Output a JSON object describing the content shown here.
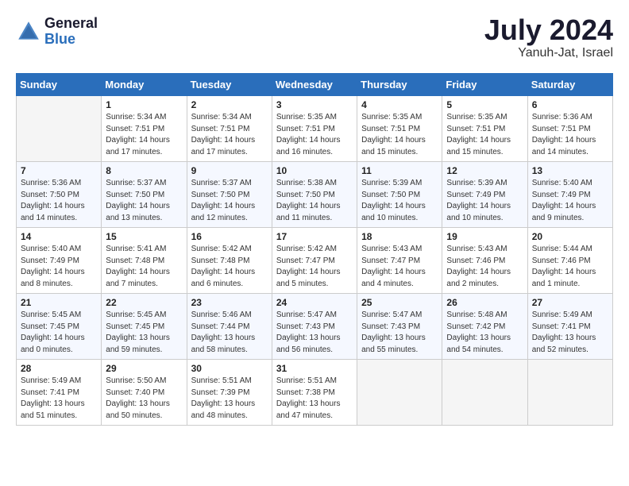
{
  "header": {
    "logo_general": "General",
    "logo_blue": "Blue",
    "month_year": "July 2024",
    "location": "Yanuh-Jat, Israel"
  },
  "days_of_week": [
    "Sunday",
    "Monday",
    "Tuesday",
    "Wednesday",
    "Thursday",
    "Friday",
    "Saturday"
  ],
  "weeks": [
    [
      {
        "day": "",
        "sunrise": "",
        "sunset": "",
        "daylight": ""
      },
      {
        "day": "1",
        "sunrise": "Sunrise: 5:34 AM",
        "sunset": "Sunset: 7:51 PM",
        "daylight": "Daylight: 14 hours and 17 minutes."
      },
      {
        "day": "2",
        "sunrise": "Sunrise: 5:34 AM",
        "sunset": "Sunset: 7:51 PM",
        "daylight": "Daylight: 14 hours and 17 minutes."
      },
      {
        "day": "3",
        "sunrise": "Sunrise: 5:35 AM",
        "sunset": "Sunset: 7:51 PM",
        "daylight": "Daylight: 14 hours and 16 minutes."
      },
      {
        "day": "4",
        "sunrise": "Sunrise: 5:35 AM",
        "sunset": "Sunset: 7:51 PM",
        "daylight": "Daylight: 14 hours and 15 minutes."
      },
      {
        "day": "5",
        "sunrise": "Sunrise: 5:35 AM",
        "sunset": "Sunset: 7:51 PM",
        "daylight": "Daylight: 14 hours and 15 minutes."
      },
      {
        "day": "6",
        "sunrise": "Sunrise: 5:36 AM",
        "sunset": "Sunset: 7:51 PM",
        "daylight": "Daylight: 14 hours and 14 minutes."
      }
    ],
    [
      {
        "day": "7",
        "sunrise": "Sunrise: 5:36 AM",
        "sunset": "Sunset: 7:50 PM",
        "daylight": "Daylight: 14 hours and 14 minutes."
      },
      {
        "day": "8",
        "sunrise": "Sunrise: 5:37 AM",
        "sunset": "Sunset: 7:50 PM",
        "daylight": "Daylight: 14 hours and 13 minutes."
      },
      {
        "day": "9",
        "sunrise": "Sunrise: 5:37 AM",
        "sunset": "Sunset: 7:50 PM",
        "daylight": "Daylight: 14 hours and 12 minutes."
      },
      {
        "day": "10",
        "sunrise": "Sunrise: 5:38 AM",
        "sunset": "Sunset: 7:50 PM",
        "daylight": "Daylight: 14 hours and 11 minutes."
      },
      {
        "day": "11",
        "sunrise": "Sunrise: 5:39 AM",
        "sunset": "Sunset: 7:50 PM",
        "daylight": "Daylight: 14 hours and 10 minutes."
      },
      {
        "day": "12",
        "sunrise": "Sunrise: 5:39 AM",
        "sunset": "Sunset: 7:49 PM",
        "daylight": "Daylight: 14 hours and 10 minutes."
      },
      {
        "day": "13",
        "sunrise": "Sunrise: 5:40 AM",
        "sunset": "Sunset: 7:49 PM",
        "daylight": "Daylight: 14 hours and 9 minutes."
      }
    ],
    [
      {
        "day": "14",
        "sunrise": "Sunrise: 5:40 AM",
        "sunset": "Sunset: 7:49 PM",
        "daylight": "Daylight: 14 hours and 8 minutes."
      },
      {
        "day": "15",
        "sunrise": "Sunrise: 5:41 AM",
        "sunset": "Sunset: 7:48 PM",
        "daylight": "Daylight: 14 hours and 7 minutes."
      },
      {
        "day": "16",
        "sunrise": "Sunrise: 5:42 AM",
        "sunset": "Sunset: 7:48 PM",
        "daylight": "Daylight: 14 hours and 6 minutes."
      },
      {
        "day": "17",
        "sunrise": "Sunrise: 5:42 AM",
        "sunset": "Sunset: 7:47 PM",
        "daylight": "Daylight: 14 hours and 5 minutes."
      },
      {
        "day": "18",
        "sunrise": "Sunrise: 5:43 AM",
        "sunset": "Sunset: 7:47 PM",
        "daylight": "Daylight: 14 hours and 4 minutes."
      },
      {
        "day": "19",
        "sunrise": "Sunrise: 5:43 AM",
        "sunset": "Sunset: 7:46 PM",
        "daylight": "Daylight: 14 hours and 2 minutes."
      },
      {
        "day": "20",
        "sunrise": "Sunrise: 5:44 AM",
        "sunset": "Sunset: 7:46 PM",
        "daylight": "Daylight: 14 hours and 1 minute."
      }
    ],
    [
      {
        "day": "21",
        "sunrise": "Sunrise: 5:45 AM",
        "sunset": "Sunset: 7:45 PM",
        "daylight": "Daylight: 14 hours and 0 minutes."
      },
      {
        "day": "22",
        "sunrise": "Sunrise: 5:45 AM",
        "sunset": "Sunset: 7:45 PM",
        "daylight": "Daylight: 13 hours and 59 minutes."
      },
      {
        "day": "23",
        "sunrise": "Sunrise: 5:46 AM",
        "sunset": "Sunset: 7:44 PM",
        "daylight": "Daylight: 13 hours and 58 minutes."
      },
      {
        "day": "24",
        "sunrise": "Sunrise: 5:47 AM",
        "sunset": "Sunset: 7:43 PM",
        "daylight": "Daylight: 13 hours and 56 minutes."
      },
      {
        "day": "25",
        "sunrise": "Sunrise: 5:47 AM",
        "sunset": "Sunset: 7:43 PM",
        "daylight": "Daylight: 13 hours and 55 minutes."
      },
      {
        "day": "26",
        "sunrise": "Sunrise: 5:48 AM",
        "sunset": "Sunset: 7:42 PM",
        "daylight": "Daylight: 13 hours and 54 minutes."
      },
      {
        "day": "27",
        "sunrise": "Sunrise: 5:49 AM",
        "sunset": "Sunset: 7:41 PM",
        "daylight": "Daylight: 13 hours and 52 minutes."
      }
    ],
    [
      {
        "day": "28",
        "sunrise": "Sunrise: 5:49 AM",
        "sunset": "Sunset: 7:41 PM",
        "daylight": "Daylight: 13 hours and 51 minutes."
      },
      {
        "day": "29",
        "sunrise": "Sunrise: 5:50 AM",
        "sunset": "Sunset: 7:40 PM",
        "daylight": "Daylight: 13 hours and 50 minutes."
      },
      {
        "day": "30",
        "sunrise": "Sunrise: 5:51 AM",
        "sunset": "Sunset: 7:39 PM",
        "daylight": "Daylight: 13 hours and 48 minutes."
      },
      {
        "day": "31",
        "sunrise": "Sunrise: 5:51 AM",
        "sunset": "Sunset: 7:38 PM",
        "daylight": "Daylight: 13 hours and 47 minutes."
      },
      {
        "day": "",
        "sunrise": "",
        "sunset": "",
        "daylight": ""
      },
      {
        "day": "",
        "sunrise": "",
        "sunset": "",
        "daylight": ""
      },
      {
        "day": "",
        "sunrise": "",
        "sunset": "",
        "daylight": ""
      }
    ]
  ]
}
